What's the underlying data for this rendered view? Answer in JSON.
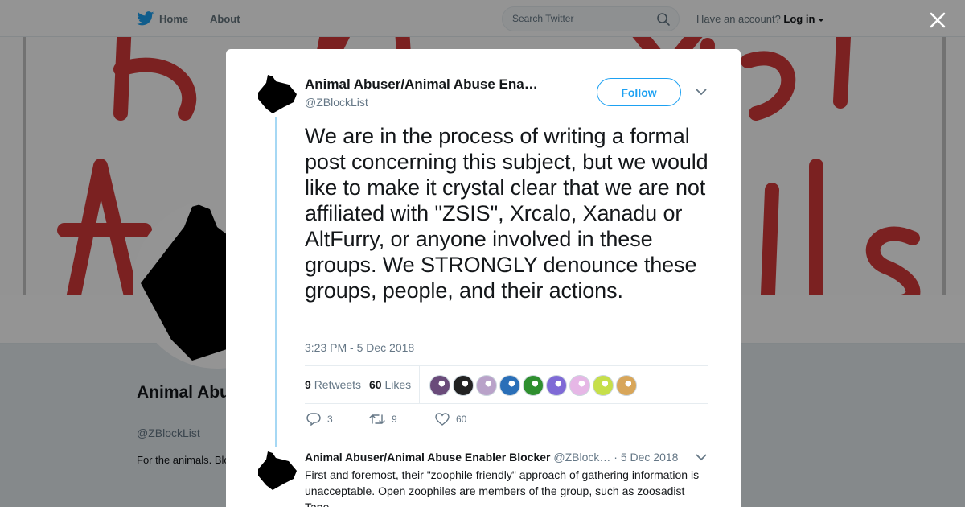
{
  "nav": {
    "home_label": "Home",
    "about_label": "About",
    "search_placeholder": "Search Twitter",
    "account_prompt": "Have an account?",
    "login_label": "Log in"
  },
  "banner": {
    "letters_color": "#d43a3a"
  },
  "profile": {
    "name": "Animal Abuser/Animal Abuse Enabler Blocker",
    "handle": "@ZBlockList",
    "bio": "For the animals. Blocking and exposing animal abusers, apologists, and enablers. Spreading awareness about the realities of animal sexual abuse."
  },
  "tweet": {
    "author_name": "Animal Abuser/Animal Abuse Ena…",
    "author_handle": "@ZBlockList",
    "follow_label": "Follow",
    "text": "We are in the process of writing a formal post concerning this subject, but we would like to make it crystal clear that we are not affiliated with \"ZSIS\", Xrcalo, Xanadu or AltFurry, or anyone involved in these groups. We STRONGLY denounce these groups, people, and their actions.",
    "timestamp": "3:23 PM - 5 Dec 2018",
    "retweets_count": "9",
    "retweets_label": "Retweets",
    "likes_count": "60",
    "likes_label": "Likes",
    "likers": [
      {
        "name": "liker-1",
        "color": "#6a4b7a"
      },
      {
        "name": "liker-2",
        "color": "#222222"
      },
      {
        "name": "liker-3",
        "color": "#b9a2c9"
      },
      {
        "name": "liker-4",
        "color": "#2a6fb8"
      },
      {
        "name": "liker-5",
        "color": "#2f8f2f"
      },
      {
        "name": "liker-6",
        "color": "#7f6ad6"
      },
      {
        "name": "liker-7",
        "color": "#e6b7e6"
      },
      {
        "name": "liker-8",
        "color": "#c6df4a"
      },
      {
        "name": "liker-9",
        "color": "#d8a65a"
      }
    ],
    "actions": {
      "reply_count": "3",
      "retweet_count": "9",
      "like_count": "60"
    }
  },
  "reply": {
    "name": "Animal Abuser/Animal Abuse Enabler Blocker",
    "handle": "@ZBlock…",
    "date": "· 5 Dec 2018",
    "text": "First and foremost, their \"zoophile friendly\" approach of gathering information is unacceptable. Open zoophiles are members of the group, such as zoosadist Tape."
  },
  "colors": {
    "accent": "#1da1f2",
    "thread_line": "#a6d8f4",
    "text_primary": "#14171a",
    "text_secondary": "#657786"
  }
}
